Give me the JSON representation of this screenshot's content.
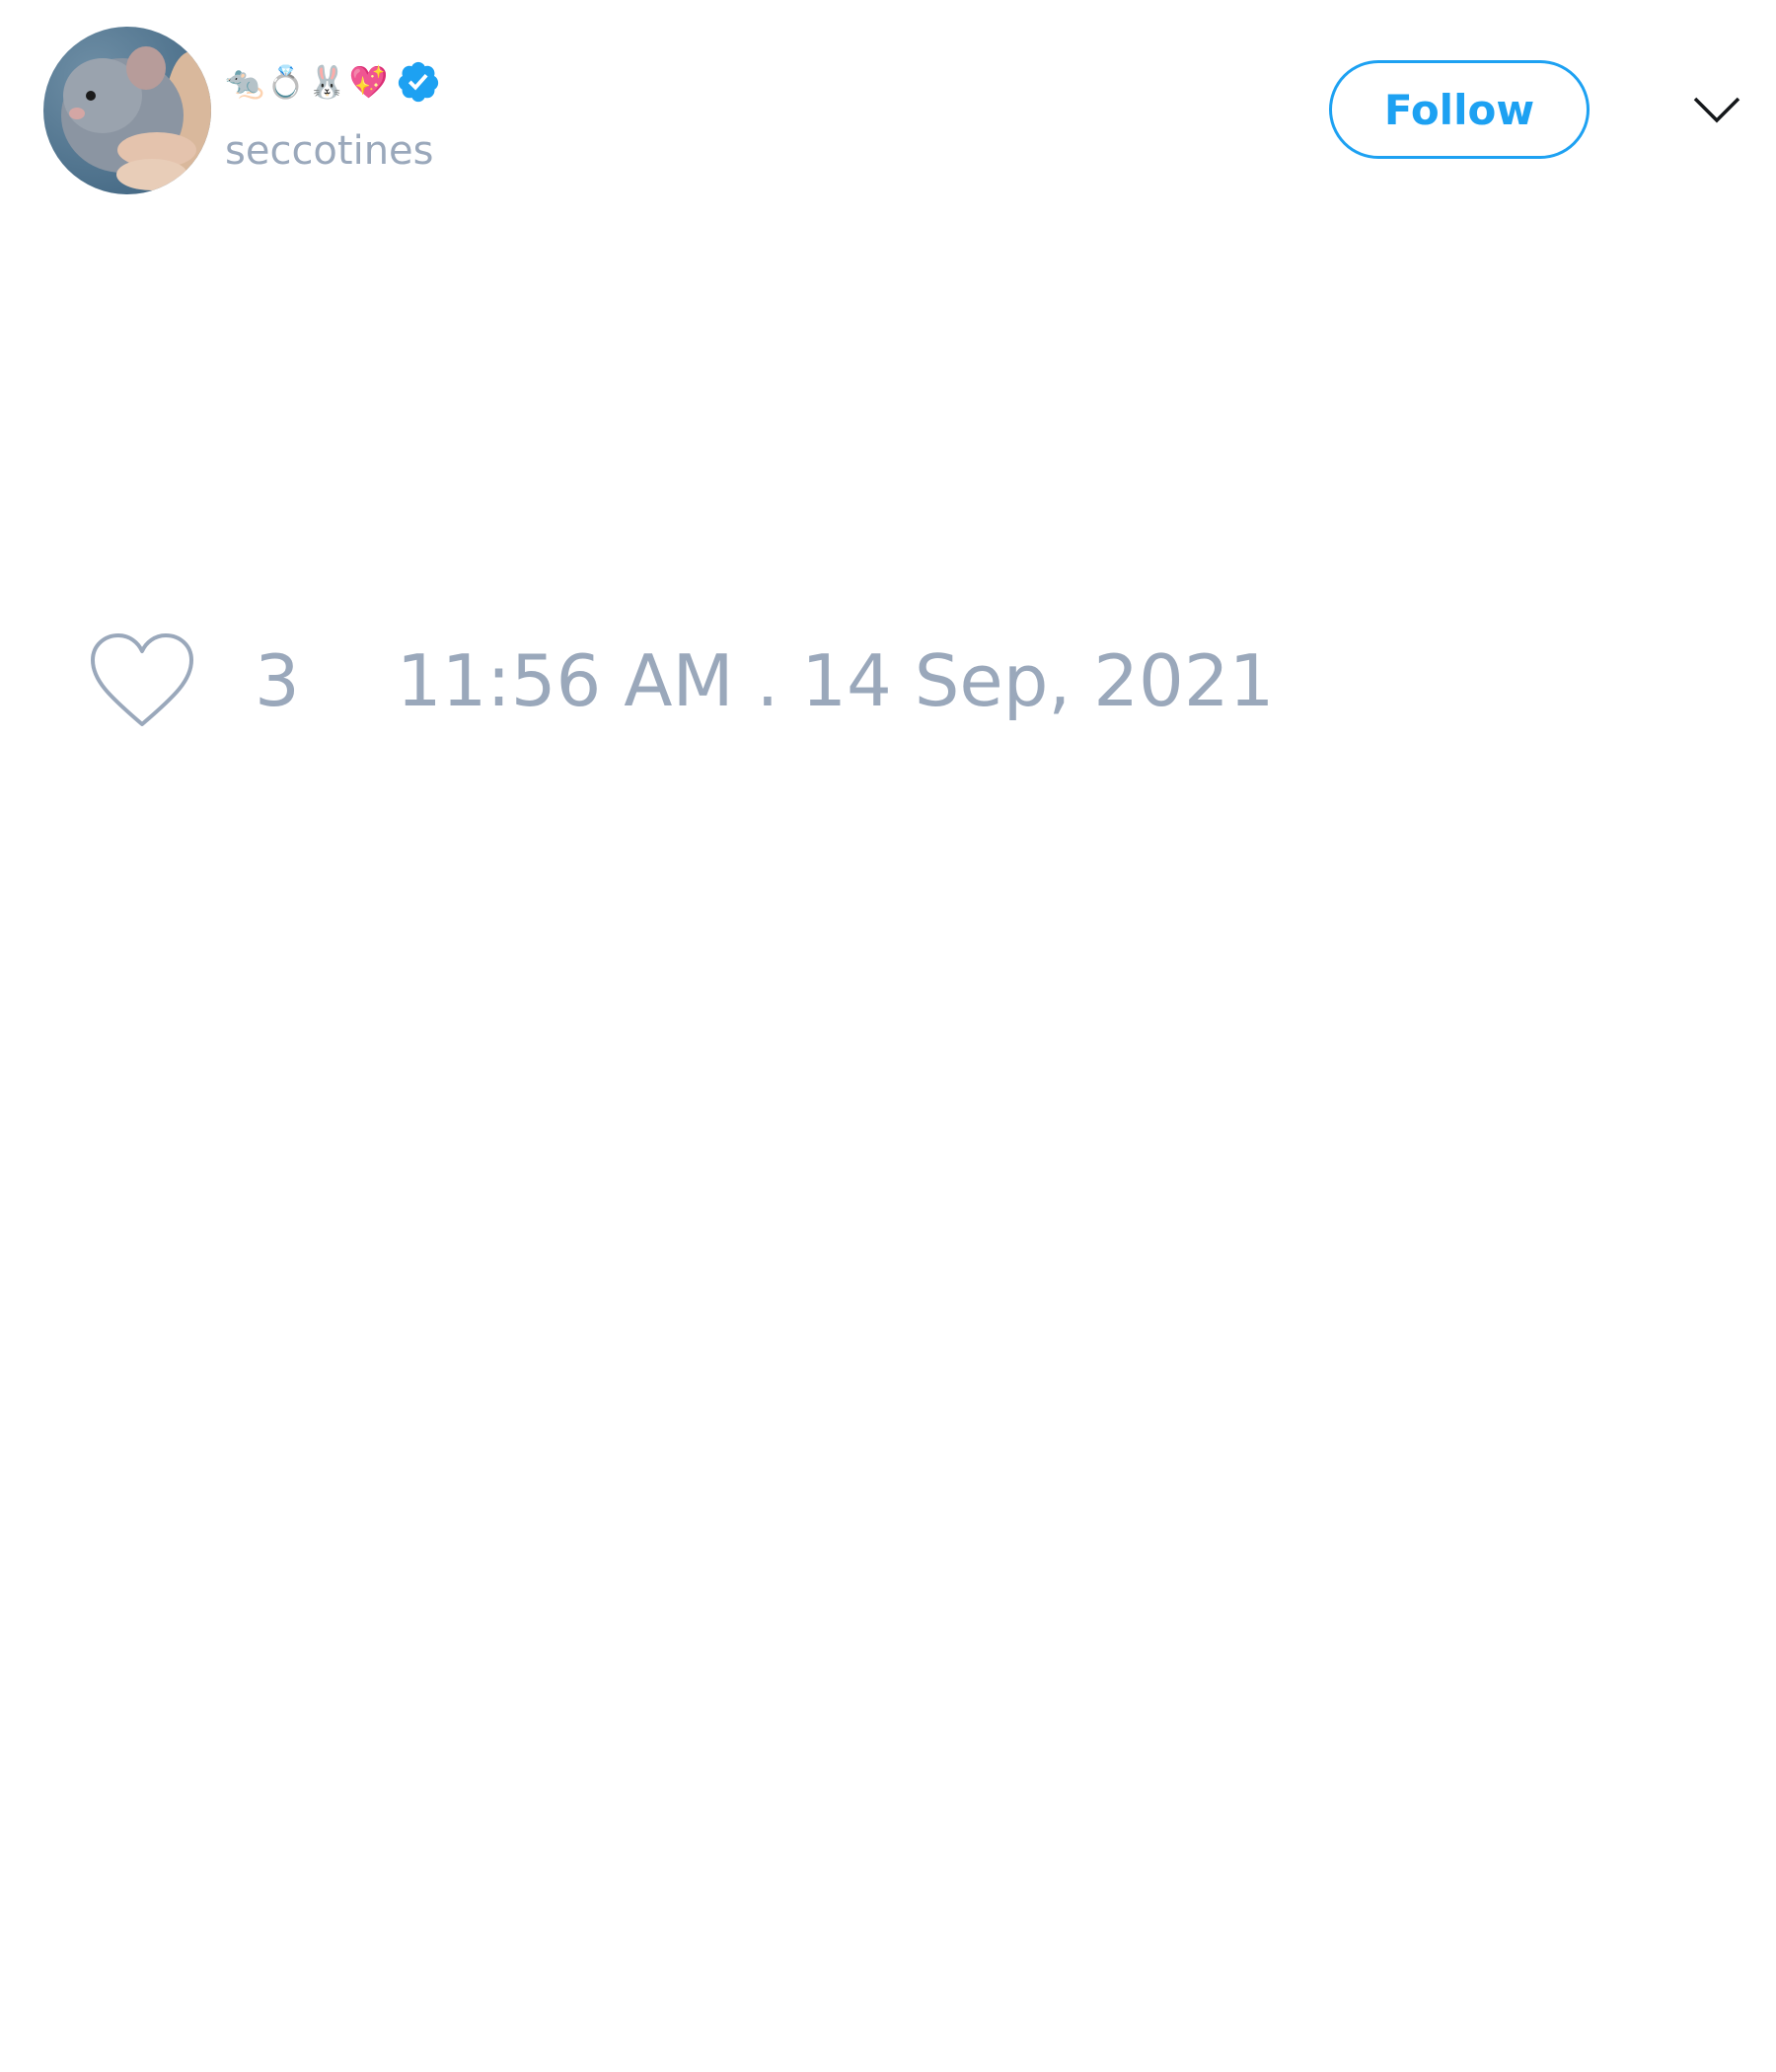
{
  "tweet": {
    "author": {
      "display_name": "🐀💍🐰💖",
      "handle": "seccotines",
      "verified": true,
      "avatar_icon": "rat-photo-avatar"
    },
    "follow_label": "Follow",
    "menu_icon": "chevron-down-icon",
    "likes": {
      "icon": "heart-outline-icon",
      "count": "3"
    },
    "timestamp": "11:56 AM . 14 Sep, 2021"
  },
  "colors": {
    "accent": "#1da1f2",
    "muted_text": "#9aa8bb",
    "background": "#ffffff"
  }
}
